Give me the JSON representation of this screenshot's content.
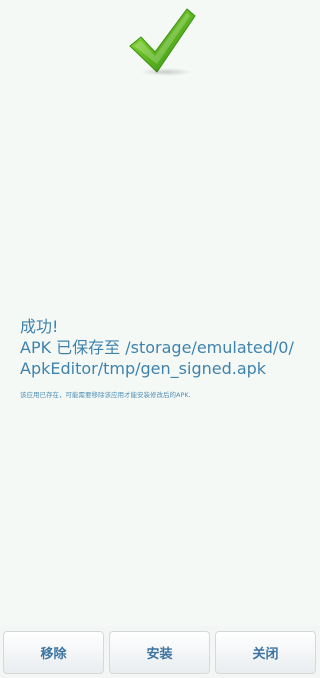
{
  "status_icon": {
    "name": "success-checkmark-icon",
    "color": "#58b11f"
  },
  "message": {
    "title": "成功!",
    "line_1": "APK 已保存至 /storage/emulated/0/",
    "line_2": "ApkEditor/tmp/gen_signed.apk"
  },
  "note": "该应用已存在，可能需要移除该应用才能安装修改后的APK.",
  "buttons": {
    "remove": "移除",
    "install": "安装",
    "close": "关闭"
  },
  "colors": {
    "background": "#f5f9f6",
    "text_blue": "#3f83ad",
    "button_text": "#3d74a1"
  }
}
